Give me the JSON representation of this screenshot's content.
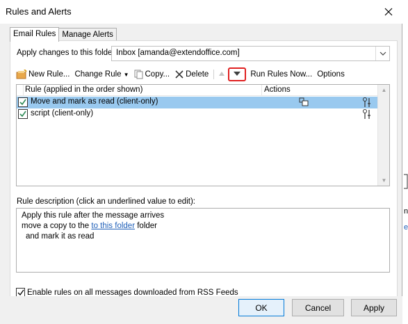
{
  "window": {
    "title": "Rules and Alerts"
  },
  "tabs": [
    {
      "label": "Email Rules"
    },
    {
      "label": "Manage Alerts"
    }
  ],
  "apply": {
    "label": "Apply changes to this folder:",
    "folder_value": "Inbox [amanda@extendoffice.com]"
  },
  "toolbar": {
    "new_rule": "New Rule...",
    "change_rule": "Change Rule",
    "copy": "Copy...",
    "delete": "Delete",
    "run_rules_now": "Run Rules Now...",
    "options": "Options"
  },
  "rules_list": {
    "col_rule": "Rule (applied in the order shown)",
    "col_actions": "Actions",
    "rows": [
      {
        "name": "Move and mark as read  (client-only)",
        "checked": true,
        "selected": true
      },
      {
        "name": "script  (client-only)",
        "checked": true,
        "selected": false
      }
    ]
  },
  "description": {
    "label": "Rule description (click an underlined value to edit):",
    "line1": "Apply this rule after the message arrives",
    "line2_pre": "move a copy to the ",
    "line2_link": "to this folder",
    "line2_post": " folder",
    "line3": "and mark it as read"
  },
  "rss": {
    "label": "Enable rules on all messages downloaded from RSS Feeds",
    "checked": true
  },
  "buttons": {
    "ok": "OK",
    "cancel": "Cancel",
    "apply": "Apply"
  },
  "background": {
    "text1": "n",
    "text2": "e"
  },
  "colors": {
    "selection": "#99c9ef",
    "highlight_border": "#e02020",
    "link": "#1f5fb8",
    "ok_border": "#0078d7"
  }
}
